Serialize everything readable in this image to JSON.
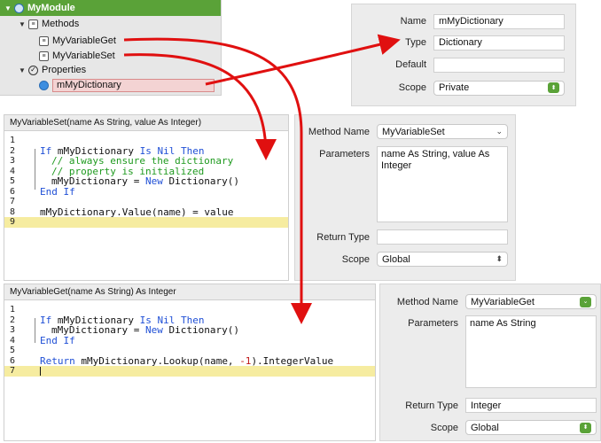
{
  "navigator": {
    "module": "MyModule",
    "methods_label": "Methods",
    "method_items": [
      "MyVariableGet",
      "MyVariableSet"
    ],
    "properties_label": "Properties",
    "property_item": "mMyDictionary"
  },
  "property_inspector": {
    "name_label": "Name",
    "name_value": "mMyDictionary",
    "type_label": "Type",
    "type_value": "Dictionary",
    "default_label": "Default",
    "default_value": "",
    "scope_label": "Scope",
    "scope_value": "Private"
  },
  "set_editor": {
    "title": "MyVariableSet(name As String, value As Integer)",
    "line_numbers": [
      "1",
      "2",
      "3",
      "4",
      "5",
      "6",
      "7",
      "8",
      "9"
    ]
  },
  "set_inspector": {
    "method_name_label": "Method Name",
    "method_name_value": "MyVariableSet",
    "parameters_label": "Parameters",
    "parameters_value": "name As String, value As Integer",
    "return_type_label": "Return Type",
    "return_type_value": "",
    "scope_label": "Scope",
    "scope_value": "Global"
  },
  "get_editor": {
    "title": "MyVariableGet(name As String) As Integer",
    "line_numbers": [
      "1",
      "2",
      "3",
      "4",
      "5",
      "6",
      "7"
    ]
  },
  "get_inspector": {
    "method_name_label": "Method Name",
    "method_name_value": "MyVariableGet",
    "parameters_label": "Parameters",
    "parameters_value": "name As String",
    "return_type_label": "Return Type",
    "return_type_value": "Integer",
    "scope_label": "Scope",
    "scope_value": "Global"
  },
  "colors": {
    "module_bar": "#5aa238",
    "arrow": "#e01010",
    "current_line": "#f6eca0",
    "keyword": "#1f4fd6",
    "comment": "#1f9a1f"
  }
}
